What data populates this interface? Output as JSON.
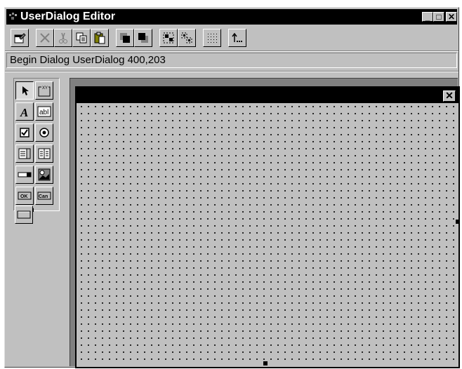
{
  "window": {
    "title": "UserDialog Editor",
    "minimize_glyph": "_",
    "maximize_glyph": "□",
    "close_glyph": "✕"
  },
  "toolbar": {
    "buttons": [
      {
        "name": "properties",
        "icon": "properties-icon"
      },
      {
        "name": "delete",
        "icon": "delete-icon"
      },
      {
        "name": "cut",
        "icon": "cut-icon"
      },
      {
        "name": "copy",
        "icon": "copy-icon"
      },
      {
        "name": "paste",
        "icon": "paste-icon"
      },
      {
        "name": "bring-to-front",
        "icon": "bring-forward-icon"
      },
      {
        "name": "send-to-back",
        "icon": "send-backward-icon"
      },
      {
        "name": "group",
        "icon": "group-icon"
      },
      {
        "name": "ungroup",
        "icon": "ungroup-icon"
      },
      {
        "name": "grid",
        "icon": "grid-icon"
      },
      {
        "name": "exit",
        "icon": "exit-icon"
      }
    ]
  },
  "command_line": {
    "text": "Begin Dialog UserDialog 400,203"
  },
  "toolbox": {
    "tools": [
      "select",
      "groupbox",
      "text",
      "textbox",
      "checkbox",
      "optionbutton",
      "listbox",
      "combobox",
      "droplistbox",
      "picture",
      "ok-button",
      "cancel-button",
      "pushbutton"
    ],
    "groupbox_glyph": "XY",
    "text_glyph": "A",
    "textbox_glyph": "abl",
    "ok_glyph": "OK",
    "cancel_glyph": "Can"
  },
  "user_dialog": {
    "close_glyph": "✕"
  }
}
